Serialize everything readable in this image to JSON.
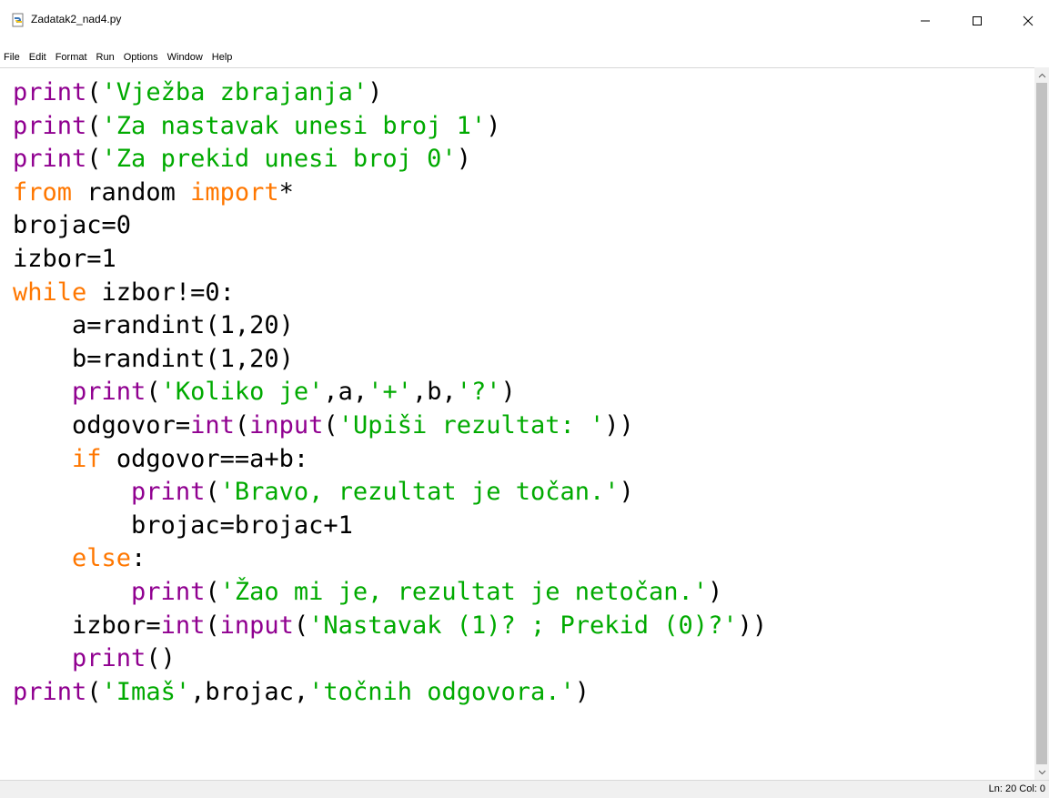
{
  "window": {
    "title": "Zadatak2_nad4.py"
  },
  "menu": [
    "File",
    "Edit",
    "Format",
    "Run",
    "Options",
    "Window",
    "Help"
  ],
  "code_lines": [
    "print('Vježba zbrajanja')",
    "print('Za nastavak unesi broj 1')",
    "print('Za prekid unesi broj 0')",
    "from random import*",
    "brojac=0",
    "izbor=1",
    "while izbor!=0:",
    "    a=randint(1,20)",
    "    b=randint(1,20)",
    "    print('Koliko je',a,'+',b,'?')",
    "    odgovor=int(input('Upiši rezultat: '))",
    "    if odgovor==a+b:",
    "        print('Bravo, rezultat je točan.')",
    "        brojac=brojac+1",
    "    else:",
    "        print('Žao mi je, rezultat je netočan.')",
    "    izbor=int(input('Nastavak (1)? ; Prekid (0)?'))",
    "    print()",
    "print('Imaš',brojac,'točnih odgovora.')"
  ],
  "status": {
    "text": "Ln: 20  Col: 0"
  },
  "colors": {
    "keyword": "#ff7700",
    "builtin": "#900090",
    "string": "#00aa00",
    "default": "#000000"
  }
}
